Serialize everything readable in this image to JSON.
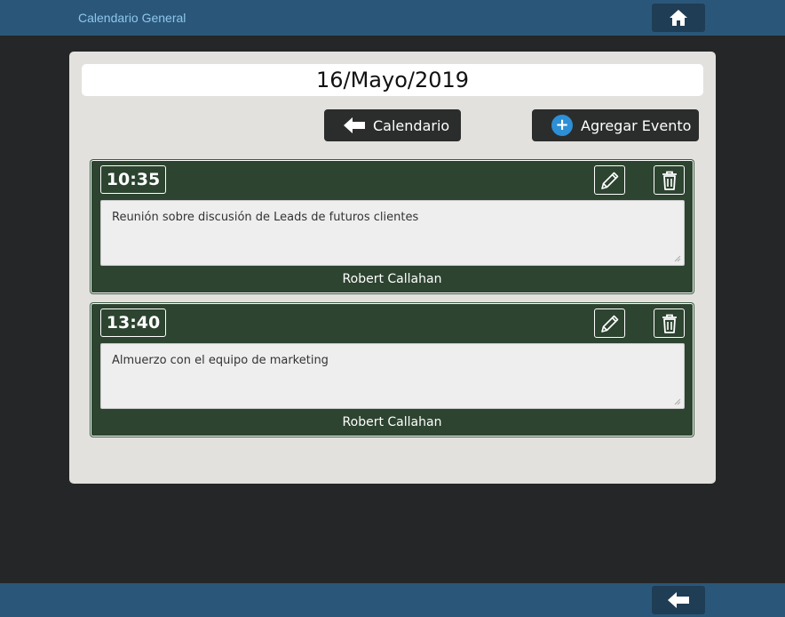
{
  "header": {
    "title": "Calendario General",
    "home_icon": "home-icon"
  },
  "main": {
    "date": "16/Mayo/2019",
    "calendar_button": {
      "label": "Calendario",
      "icon": "arrow-left-icon"
    },
    "add_event_button": {
      "label": "Agregar Evento",
      "icon": "plus-circle-icon"
    }
  },
  "events": [
    {
      "time": "10:35",
      "description": "Reunión sobre discusión de Leads de futuros clientes",
      "author": "Robert Callahan"
    },
    {
      "time": "13:40",
      "description": "Almuerzo con el equipo de marketing",
      "author": "Robert Callahan"
    }
  ],
  "footer": {
    "back_icon": "arrow-left-icon"
  },
  "colors": {
    "topbar": "#2a5779",
    "background": "#252627",
    "panel": "#e2e1de",
    "event_card": "#2d4430",
    "accent_plus": "#2d8fd6",
    "title_text": "#8fc6ec"
  }
}
